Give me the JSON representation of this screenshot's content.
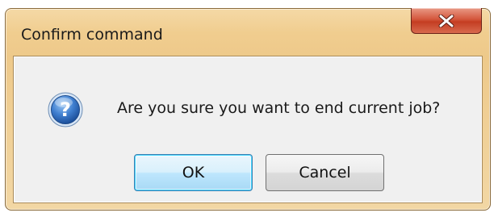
{
  "dialog": {
    "title": "Confirm command",
    "message": "Are you sure you want to end current job?",
    "icon": "question-icon",
    "buttons": {
      "ok_label": "OK",
      "cancel_label": "Cancel"
    },
    "colors": {
      "frame": "#f0cd8f",
      "close_button": "#c43d22",
      "client_background": "#f0f0f0",
      "icon_blue": "#2a6cc4"
    }
  }
}
